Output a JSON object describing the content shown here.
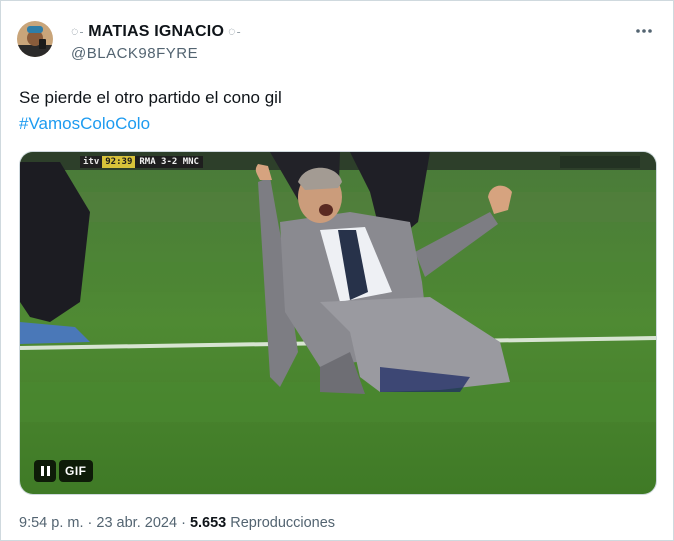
{
  "author": {
    "display_name": "MATIAS IGNACIO",
    "name_decoration": "ꩽ",
    "handle": "@BLACK98FYRE"
  },
  "more_icon": "more-horizontal-icon",
  "tweet": {
    "text": "Se pierde el otro partido el cono gil",
    "hashtag": "#VamosColoColo"
  },
  "media": {
    "type": "GIF",
    "gif_label": "GIF",
    "scorebug": {
      "channel": "itv",
      "clock": "92:39",
      "score": "RMA 3-2 MNC"
    }
  },
  "meta": {
    "time": "9:54 p. m.",
    "separator": "·",
    "date": "23 abr. 2024",
    "views_count": "5.653",
    "views_label": "Reproducciones"
  },
  "colors": {
    "accent": "#1d9bf0",
    "secondary_text": "#536471",
    "primary_text": "#0f1419",
    "border": "#cfd9de"
  }
}
